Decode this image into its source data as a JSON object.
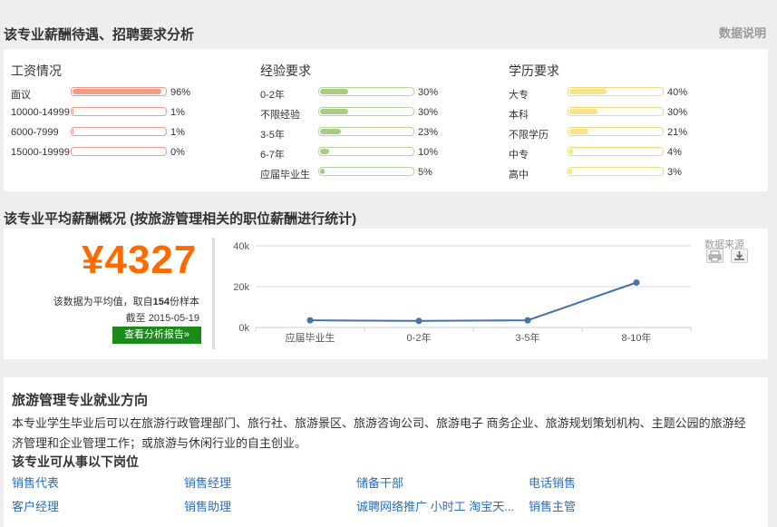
{
  "header": {
    "title": "该专业薪酬待遇、招聘要求分析",
    "note_link": "数据说明"
  },
  "salary_col": {
    "title": "工资情况",
    "rows": [
      {
        "label": "面议",
        "pct": "96%",
        "fill": 0.96
      },
      {
        "label": "10000-14999",
        "pct": "1%",
        "fill": 0.01
      },
      {
        "label": "6000-7999",
        "pct": "1%",
        "fill": 0.01
      },
      {
        "label": "15000-19999",
        "pct": "0%",
        "fill": 0.0
      }
    ]
  },
  "exp_col": {
    "title": "经验要求",
    "rows": [
      {
        "label": "0-2年",
        "pct": "30%",
        "fill": 0.3
      },
      {
        "label": "不限经验",
        "pct": "30%",
        "fill": 0.3
      },
      {
        "label": "3-5年",
        "pct": "23%",
        "fill": 0.23
      },
      {
        "label": "6-7年",
        "pct": "10%",
        "fill": 0.1
      },
      {
        "label": "应届毕业生",
        "pct": "5%",
        "fill": 0.05
      }
    ]
  },
  "edu_col": {
    "title": "学历要求",
    "rows": [
      {
        "label": "大专",
        "pct": "40%",
        "fill": 0.4
      },
      {
        "label": "本科",
        "pct": "30%",
        "fill": 0.3
      },
      {
        "label": "不限学历",
        "pct": "21%",
        "fill": 0.21
      },
      {
        "label": "中专",
        "pct": "4%",
        "fill": 0.04
      },
      {
        "label": "高中",
        "pct": "3%",
        "fill": 0.03
      }
    ]
  },
  "avg": {
    "title": "该专业平均薪酬概况 (按旅游管理相关的职位薪酬进行统计)",
    "salary": "¥4327",
    "sample_prefix": "该数据为平均值，取自",
    "sample_count": "154",
    "sample_suffix": "份样本",
    "date": "截至 2015-05-19",
    "report_button": "查看分析报告»",
    "source_label": "数据来源"
  },
  "chart_data": {
    "type": "line",
    "categories": [
      "应届毕业生",
      "0-2年",
      "3-5年",
      "8-10年"
    ],
    "values": [
      3500,
      3200,
      3500,
      22000
    ],
    "y_ticks": [
      "0k",
      "20k",
      "40k"
    ],
    "ylim": [
      0,
      40000
    ],
    "grid": true,
    "line_color": "#4572a7"
  },
  "direction": {
    "title": "旅游管理专业就业方向",
    "desc": "本专业学生毕业后可以在旅游行政管理部门、旅行社、旅游景区、旅游咨询公司、旅游电子 商务企业、旅游规划策划机构、主题公园的旅游经济管理和企业管理工作；或旅游与休闲行业的自主创业。",
    "jobs_title": "该专业可从事以下岗位",
    "jobs": [
      "销售代表",
      "销售经理",
      "储备干部",
      "电话销售",
      "客户经理",
      "销售助理",
      "诚聘网络推广 小时工 淘宝天...",
      "销售主管"
    ]
  }
}
